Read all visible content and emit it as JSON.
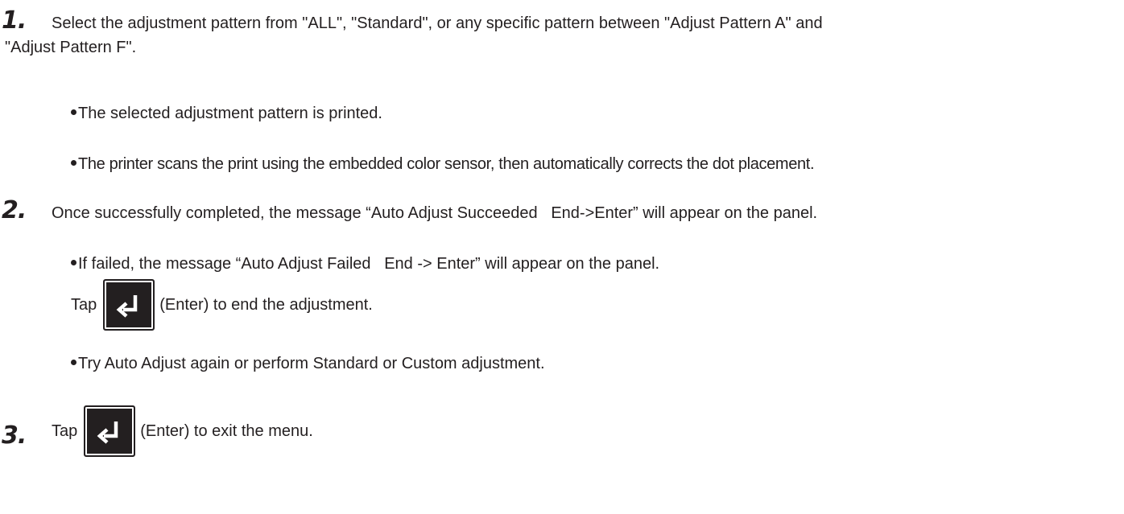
{
  "steps": [
    {
      "number": "1.",
      "text_line1": "Select the adjustment pattern from \"ALL\", \"Standard\", or any specific pattern between \"Adjust Pattern A\" and",
      "text_line2": "\"Adjust Pattern F\".",
      "bullets": [
        "The selected adjustment pattern is printed.",
        "The printer scans the print using the embedded color sensor, then automatically corrects the dot placement."
      ]
    },
    {
      "number": "2.",
      "text": "Once successfully completed, the message “Auto Adjust Succeeded   End->Enter” will appear on the panel.",
      "bullets": [
        "If failed, the message “Auto Adjust Failed   End -> Enter” will appear on the panel."
      ],
      "tap_prefix": "Tap",
      "tap_suffix": "(Enter) to end the adjustment.",
      "bullets_after": [
        "Try Auto Adjust again or perform Standard or Custom adjustment."
      ]
    },
    {
      "number": "3.",
      "tap_prefix": "Tap",
      "tap_suffix": "(Enter) to exit the menu."
    }
  ],
  "icons": {
    "enter_key": "enter-return-arrow-icon"
  },
  "colors": {
    "text": "#231f20",
    "key_background": "#231f20",
    "key_symbol": "#ffffff"
  }
}
